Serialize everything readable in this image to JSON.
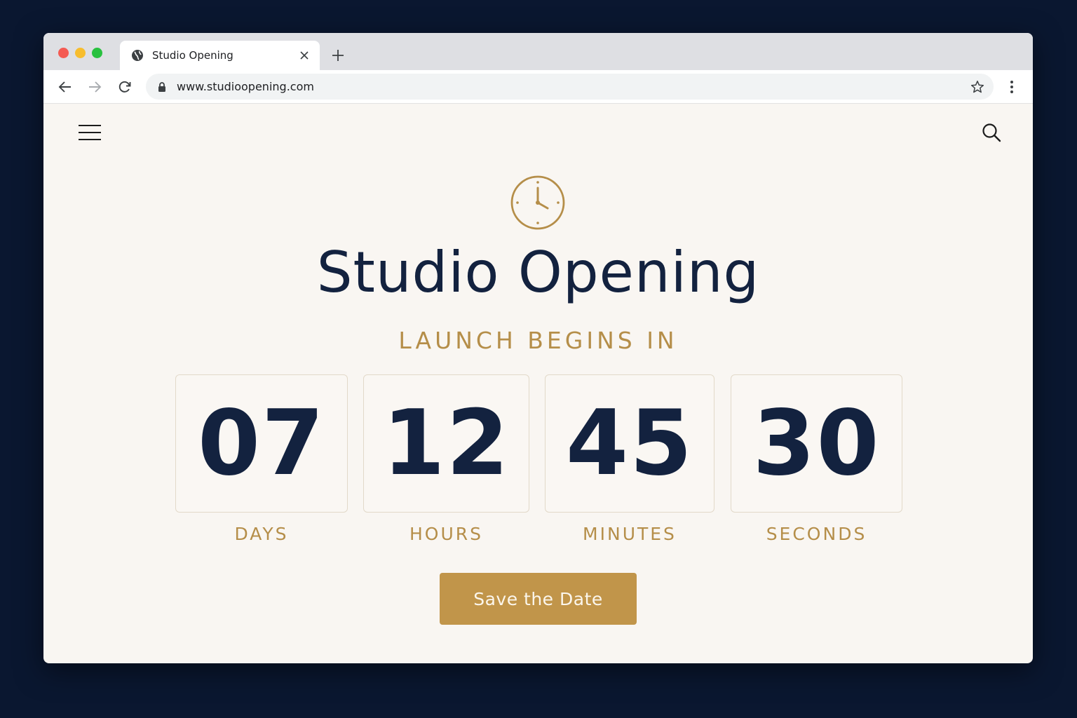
{
  "browser": {
    "tab_title": "Studio Opening",
    "url": "www.studioopening.com",
    "icons": {
      "favicon": "globe-icon",
      "close": "close-icon",
      "new_tab": "plus-icon",
      "back": "arrow-left-icon",
      "forward": "arrow-right-icon",
      "reload": "reload-icon",
      "lock": "lock-icon",
      "bookmark": "star-icon",
      "menu": "kebab-menu-icon"
    }
  },
  "page": {
    "title": "Studio Opening",
    "subtitle": "LAUNCH BEGINS IN",
    "countdown": [
      {
        "value": "07",
        "label": "DAYS"
      },
      {
        "value": "12",
        "label": "HOURS"
      },
      {
        "value": "45",
        "label": "MINUTES"
      },
      {
        "value": "30",
        "label": "SECONDS"
      }
    ],
    "cta_label": "Save the Date",
    "icons": {
      "menu": "hamburger-menu-icon",
      "search": "search-icon",
      "hero": "clock-icon"
    }
  },
  "colors": {
    "backdrop": "#0a1730",
    "page_bg": "#f9f6f2",
    "navy": "#13223f",
    "gold": "#b58e49",
    "button": "#c1954a"
  }
}
